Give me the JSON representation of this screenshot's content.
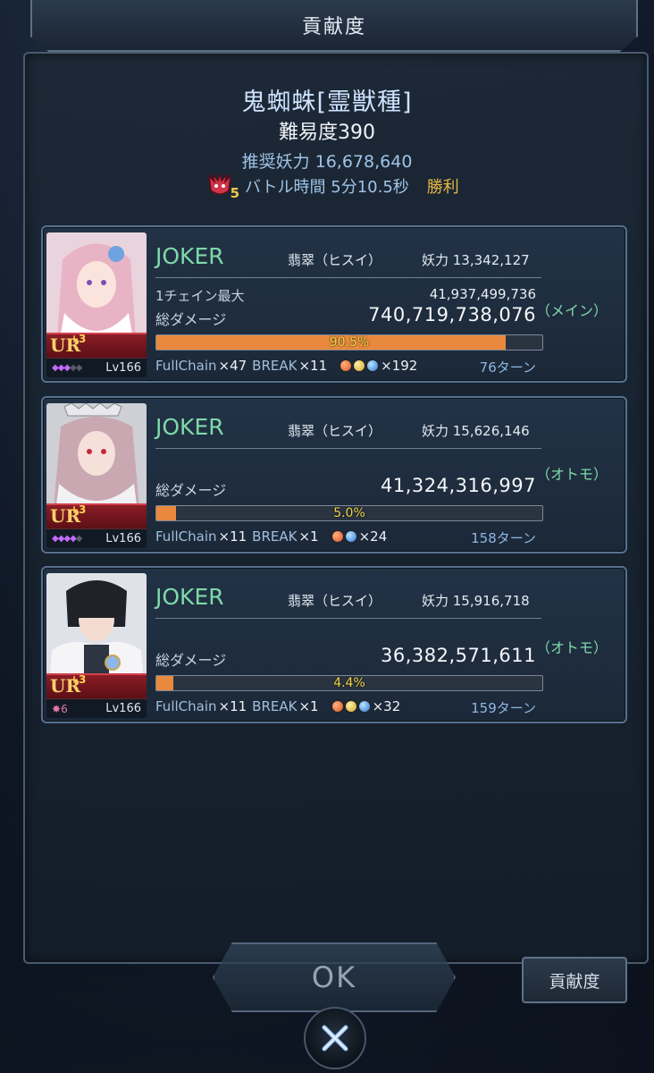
{
  "header": {
    "title": "貢献度"
  },
  "boss": {
    "name": "鬼蜘蛛[霊獣種]",
    "difficulty": "難易度390",
    "recommended_power": "推奨妖力 16,678,640",
    "badge_level": "5",
    "battle_time": "バトル時間 5分10.5秒",
    "result": "勝利"
  },
  "players": [
    {
      "name": "JOKER",
      "attribute": "翡翠（ヒスイ）",
      "power": "妖力 13,342,127",
      "chain_label": "1チェイン最大",
      "chain_value": "41,937,499,736",
      "damage_label": "総ダメージ",
      "damage_value": "740,719,738,076",
      "role": "（メイン）",
      "percent_text": "90.5%",
      "percent": 90.5,
      "fullchain_label": "FullChain",
      "fullchain_count": "×47",
      "break_label": "BREAK",
      "break_count": "×11",
      "orbs": [
        "red",
        "yellow",
        "blue"
      ],
      "orb_count": "×192",
      "turns": "76ターン",
      "level": "Lv166",
      "rank_plus": "+3",
      "rank": "UR"
    },
    {
      "name": "JOKER",
      "attribute": "翡翠（ヒスイ）",
      "power": "妖力 15,626,146",
      "damage_label": "総ダメージ",
      "damage_value": "41,324,316,997",
      "role": "（オトモ）",
      "percent_text": "5.0%",
      "percent": 5.0,
      "fullchain_label": "FullChain",
      "fullchain_count": "×11",
      "break_label": "BREAK",
      "break_count": "×1",
      "orbs": [
        "red",
        "blue"
      ],
      "orb_count": "×24",
      "turns": "158ターン",
      "level": "Lv166",
      "rank_plus": "+3",
      "rank": "UR"
    },
    {
      "name": "JOKER",
      "attribute": "翡翠（ヒスイ）",
      "power": "妖力 15,916,718",
      "damage_label": "総ダメージ",
      "damage_value": "36,382,571,611",
      "role": "（オトモ）",
      "percent_text": "4.4%",
      "percent": 4.4,
      "fullchain_label": "FullChain",
      "fullchain_count": "×11",
      "break_label": "BREAK",
      "break_count": "×1",
      "orbs": [
        "red",
        "yellow",
        "blue"
      ],
      "orb_count": "×32",
      "turns": "159ターン",
      "level": "Lv166",
      "rank_plus": "+3",
      "rank": "UR",
      "star_count": "6"
    }
  ],
  "buttons": {
    "ok": "OK",
    "contribution": "貢献度",
    "close_icon": "close-x-icon"
  },
  "colors": {
    "player_name": "#7ed9a8",
    "progress_fill": "#e9893d",
    "percent_text": "#f2d44a",
    "victory": "#e8b843"
  }
}
